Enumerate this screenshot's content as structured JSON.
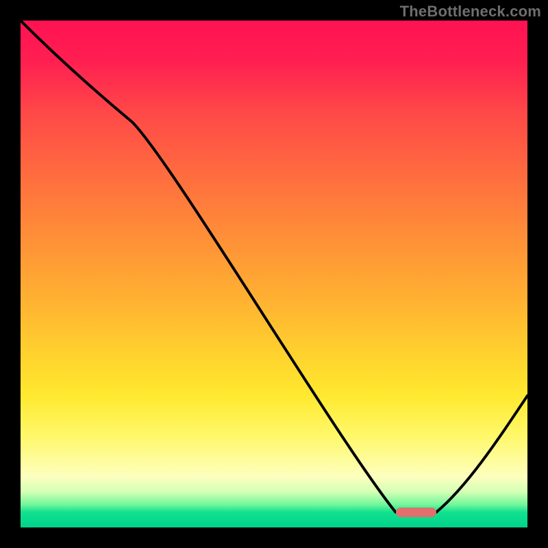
{
  "watermark": "TheBottleneck.com",
  "colors": {
    "background": "#000000",
    "line": "#000000",
    "marker": "#e06f6d",
    "gradient_top": "#ff1252",
    "gradient_bottom": "#00d38a"
  },
  "chart_data": {
    "type": "line",
    "title": "",
    "xlabel": "",
    "ylabel": "",
    "xlim": [
      0,
      100
    ],
    "ylim": [
      0,
      100
    ],
    "y_inverted_display": true,
    "x": [
      0,
      22,
      74,
      82,
      100
    ],
    "values": [
      0,
      20,
      97,
      97,
      74
    ],
    "marker": {
      "x0": 74,
      "x1": 82,
      "y": 97
    },
    "notes": "y is fraction from chart top (0) to bottom (100); curve drops from top-left, flattens near bottom at ~x=74–82, then rises toward right"
  }
}
